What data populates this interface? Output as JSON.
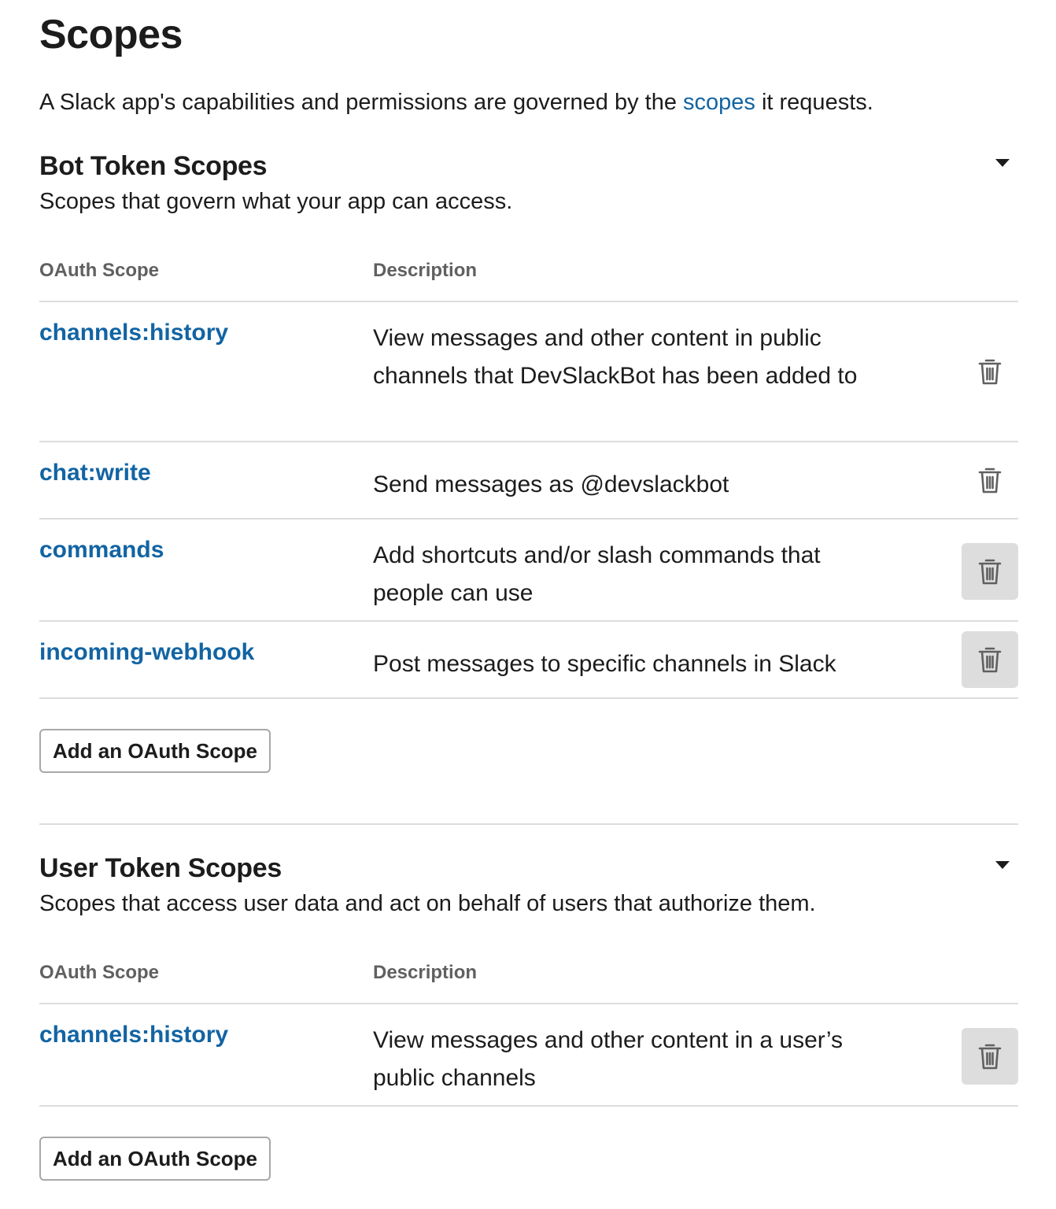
{
  "page": {
    "title": "Scopes",
    "intro_before": "A Slack app's capabilities and permissions are governed by the ",
    "intro_link": "scopes",
    "intro_after": " it requests."
  },
  "bot": {
    "title": "Bot Token Scopes",
    "subtitle": "Scopes that govern what your app can access.",
    "col_scope": "OAuth Scope",
    "col_desc": "Description",
    "rows": [
      {
        "scope": "channels:history",
        "description": "View messages and other content in public channels that DevSlackBot has been added to"
      },
      {
        "scope": "chat:write",
        "description": "Send messages as @devslackbot"
      },
      {
        "scope": "commands",
        "description": "Add shortcuts and/or slash commands that people can use"
      },
      {
        "scope": "incoming-webhook",
        "description": "Post messages to specific channels in Slack"
      }
    ],
    "add_button": "Add an OAuth Scope"
  },
  "user": {
    "title": "User Token Scopes",
    "subtitle": "Scopes that access user data and act on behalf of users that authorize them.",
    "col_scope": "OAuth Scope",
    "col_desc": "Description",
    "rows": [
      {
        "scope": "channels:history",
        "description": "View messages and other content in a user’s public channels"
      }
    ],
    "add_button": "Add an OAuth Scope"
  },
  "icons": {
    "collapse": "caret-down-icon",
    "remove": "trash-icon"
  },
  "colors": {
    "link": "#1264a3",
    "text": "#1d1c1d",
    "muted": "#616061",
    "border": "#dddddd",
    "hover_bg": "#dddddd"
  }
}
